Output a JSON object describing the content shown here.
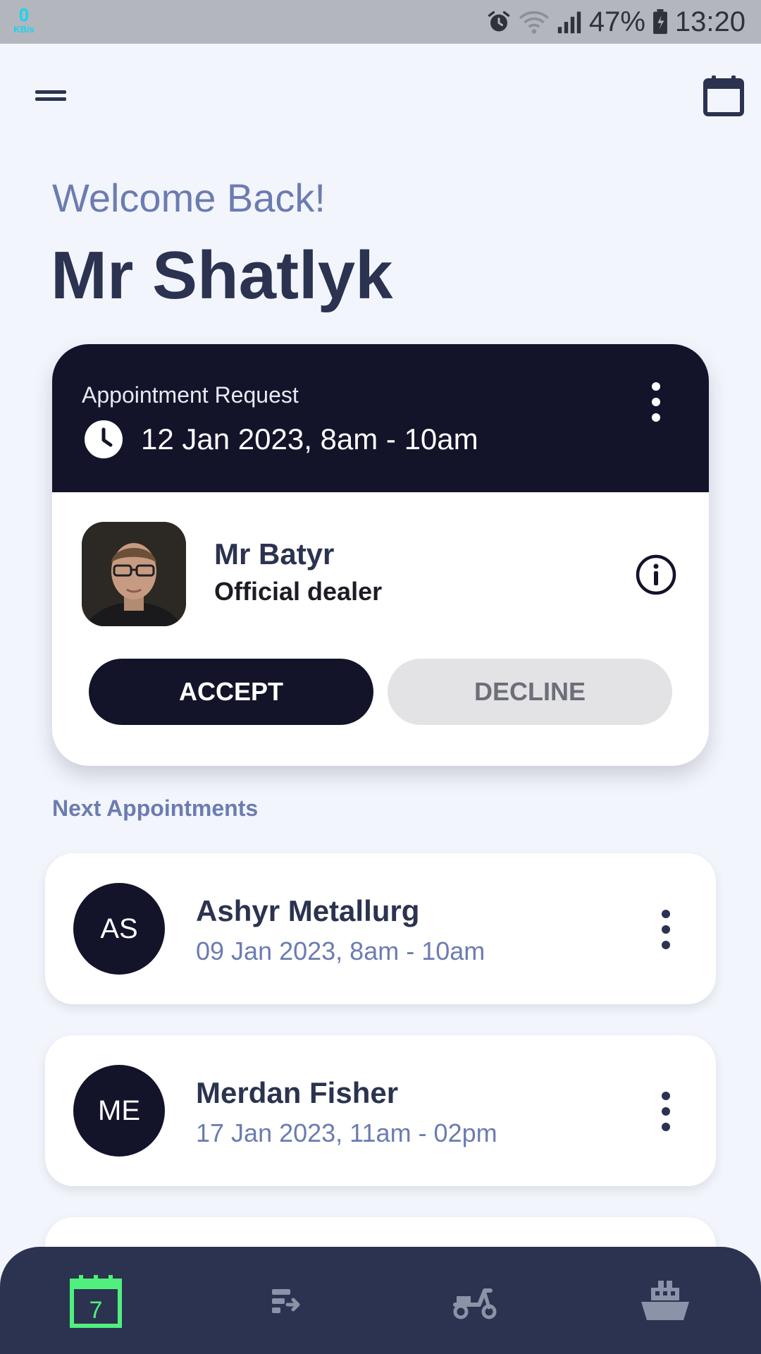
{
  "status_bar": {
    "net_speed": "0",
    "net_unit": "KB/s",
    "battery": "47%",
    "time": "13:20",
    "icons": [
      "alarm-icon",
      "wifi-icon",
      "signal-icon",
      "battery-icon"
    ]
  },
  "header": {
    "welcome": "Welcome Back!",
    "user_name": "Mr Shatlyk",
    "icons": [
      "menu-icon",
      "calendar-icon"
    ]
  },
  "request": {
    "label": "Appointment Request",
    "time": "12 Jan 2023, 8am - 10am",
    "dealer_name": "Mr Batyr",
    "dealer_role": "Official dealer",
    "accept_label": "ACCEPT",
    "decline_label": "DECLINE"
  },
  "next_section": {
    "title": "Next Appointments",
    "items": [
      {
        "initials": "AS",
        "name": "Ashyr Metallurg",
        "time": "09 Jan 2023, 8am - 10am"
      },
      {
        "initials": "ME",
        "name": "Merdan Fisher",
        "time": "17 Jan 2023, 11am - 02pm"
      }
    ]
  },
  "bottom_nav": {
    "calendar_day": "7",
    "items": [
      "calendar-tab-icon",
      "list-tab-icon",
      "scooter-tab-icon",
      "ship-tab-icon"
    ]
  },
  "colors": {
    "background": "#f3f5fc",
    "dark": "#13142a",
    "text": "#2b3350",
    "muted": "#6b7cb0",
    "nav_active": "#4ff07d",
    "nav_inactive": "#8b93a8"
  }
}
